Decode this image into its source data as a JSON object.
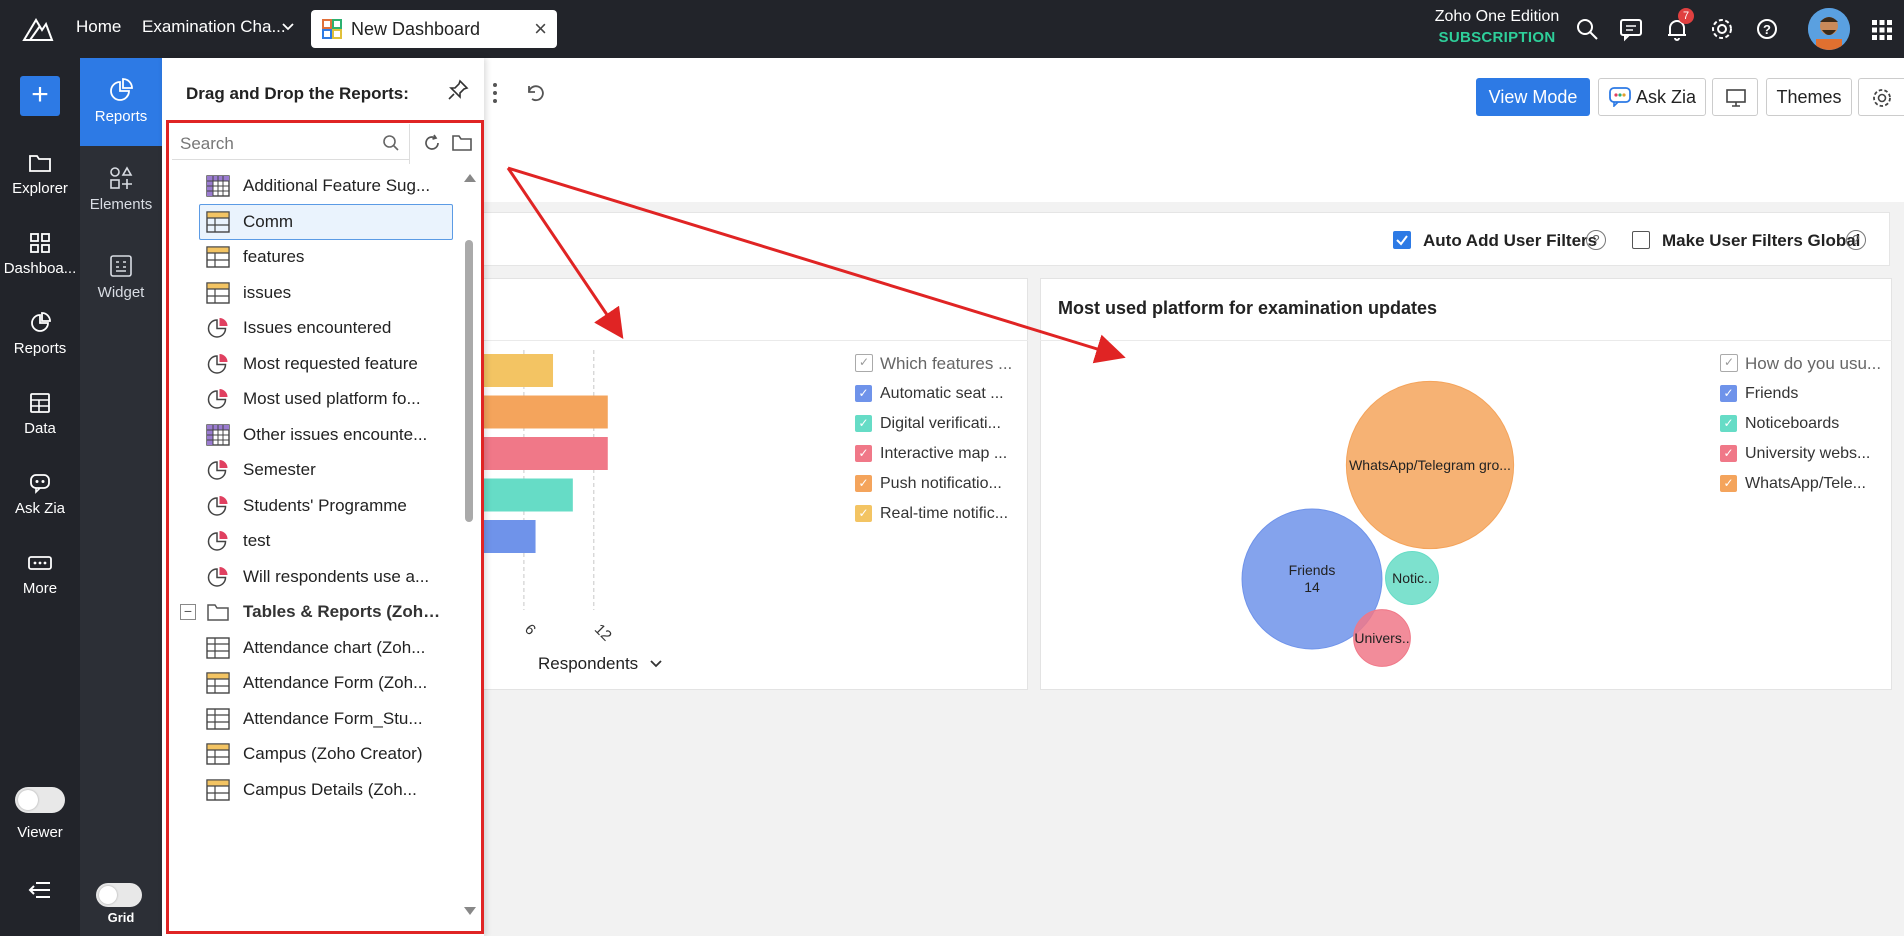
{
  "topbar": {
    "home": "Home",
    "examination_tab": "Examination Cha...",
    "active_tab": "New Dashboard",
    "edition_name": "Zoho One Edition",
    "edition_sub": "SUBSCRIPTION",
    "notification_count": "7"
  },
  "leftnav": {
    "plus": "+",
    "items": [
      {
        "label": "Explorer",
        "icon": "folder-icon"
      },
      {
        "label": "Dashboa...",
        "icon": "dashboard-grid-icon"
      },
      {
        "label": "Reports",
        "icon": "pie-chart-icon"
      },
      {
        "label": "Data",
        "icon": "table-icon"
      },
      {
        "label": "Ask Zia",
        "icon": "zia-bot-icon"
      },
      {
        "label": "More",
        "icon": "more-dots-icon"
      }
    ],
    "viewer_label": "Viewer",
    "menu_icon": "collapse-menu-icon"
  },
  "secnav": {
    "items": [
      {
        "label": "Reports",
        "active": true
      },
      {
        "label": "Elements",
        "active": false
      },
      {
        "label": "Widget",
        "active": false
      }
    ],
    "grid_label": "Grid"
  },
  "panel": {
    "title": "Drag and Drop the Reports:",
    "search_placeholder": "Search",
    "items": [
      {
        "label": "Additional Feature Sug...",
        "type": "pivot"
      },
      {
        "label": "Comm",
        "type": "table",
        "selected": true
      },
      {
        "label": "features",
        "type": "table"
      },
      {
        "label": "issues",
        "type": "table"
      },
      {
        "label": "Issues encountered",
        "type": "chart"
      },
      {
        "label": "Most requested feature",
        "type": "chart"
      },
      {
        "label": "Most used platform fo...",
        "type": "chart"
      },
      {
        "label": "Other issues encounte...",
        "type": "pivot"
      },
      {
        "label": "Semester",
        "type": "chart"
      },
      {
        "label": "Students' Programme",
        "type": "chart"
      },
      {
        "label": "test",
        "type": "chart"
      },
      {
        "label": "Will respondents use a...",
        "type": "chart"
      },
      {
        "label": "Tables & Reports (Zoho ...",
        "type": "folder"
      },
      {
        "label": "Attendance chart (Zoh...",
        "type": "table-grid"
      },
      {
        "label": "Attendance Form (Zoh...",
        "type": "table"
      },
      {
        "label": "Attendance Form_Stu...",
        "type": "table-grid"
      },
      {
        "label": "Campus (Zoho Creator)",
        "type": "table"
      },
      {
        "label": "Campus Details (Zoh...",
        "type": "table"
      }
    ]
  },
  "toolbar": {
    "view_mode": "View Mode",
    "ask_zia": "Ask Zia",
    "themes": "Themes"
  },
  "filters": {
    "auto_add": "Auto Add User Filters",
    "auto_add_checked": true,
    "make_global": "Make User Filters Global",
    "make_global_checked": false
  },
  "colors": {
    "accent": "#2d7ae5",
    "annotation_red": "#e02424",
    "blue": "#6f93ea",
    "teal": "#66dcc6",
    "pink": "#f07888",
    "orange": "#f4a45c",
    "yellow": "#f3c463"
  },
  "chart_data": [
    {
      "type": "bar",
      "orientation": "horizontal",
      "title": "",
      "xlabel": "Respondents",
      "tick_labels": [
        "6",
        "12"
      ],
      "legend_title": "Which features ...",
      "legend": [
        "Automatic seat ...",
        "Digital verificati...",
        "Interactive map ...",
        "Push notificatio...",
        "Real-time notific..."
      ],
      "series": [
        {
          "name": "Real-time notific...",
          "value": 8.5,
          "color": "#f3c463"
        },
        {
          "name": "Push notificatio...",
          "value": 13.2,
          "color": "#f4a45c"
        },
        {
          "name": "Interactive map ...",
          "value": 13.2,
          "color": "#f07888"
        },
        {
          "name": "Digital verificati...",
          "value": 10.2,
          "color": "#66dcc6"
        },
        {
          "name": "Automatic seat ...",
          "value": 7.0,
          "color": "#6f93ea"
        }
      ]
    },
    {
      "type": "bubble",
      "title": "Most used platform for examination updates",
      "legend_title": "How do you usu...",
      "legend": [
        "Friends",
        "Noticeboards",
        "University webs...",
        "WhatsApp/Tele..."
      ],
      "bubbles": [
        {
          "label": "WhatsApp/Telegram gro...",
          "value": 20,
          "color": "#f4a45c"
        },
        {
          "label": "Friends",
          "value": 14,
          "value_label": "14",
          "color": "#6f93ea"
        },
        {
          "label": "Notic..",
          "value": 2,
          "color": "#66dcc6"
        },
        {
          "label": "Univers..",
          "value": 2.3,
          "color": "#f07888"
        }
      ]
    }
  ]
}
